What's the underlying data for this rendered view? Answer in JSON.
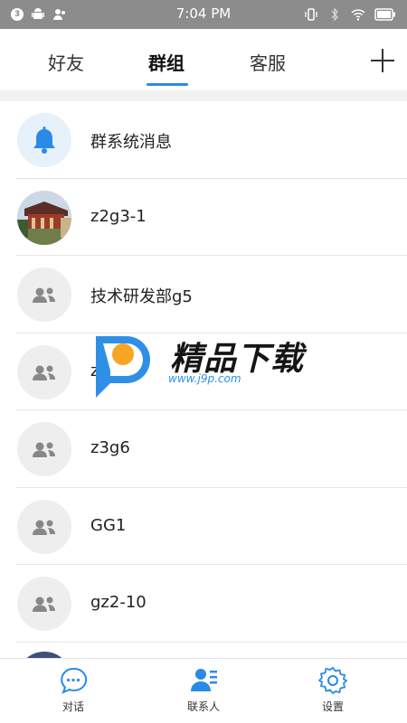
{
  "status_bar": {
    "notification_count": "3",
    "time": "7:04 PM",
    "icons_left": [
      "notification-count-icon",
      "android-icon",
      "contacts-icon"
    ],
    "icons_right": [
      "vibrate-icon",
      "bluetooth-icon",
      "wifi-icon",
      "battery-icon"
    ]
  },
  "tabs": [
    {
      "label": "好友",
      "active": false
    },
    {
      "label": "群组",
      "active": true
    },
    {
      "label": "客服",
      "active": false
    }
  ],
  "add_icon": "plus-icon",
  "groups": [
    {
      "title": "群系统消息",
      "avatar": "bell-icon"
    },
    {
      "title": "z2g3-1",
      "avatar": "photo"
    },
    {
      "title": "技术研发部g5",
      "avatar": "group-icon"
    },
    {
      "title": "z1-1",
      "avatar": "group-icon"
    },
    {
      "title": "z3g6",
      "avatar": "group-icon"
    },
    {
      "title": "GG1",
      "avatar": "group-icon"
    },
    {
      "title": "gz2-10",
      "avatar": "group-icon"
    }
  ],
  "watermark": {
    "title": "精品下载",
    "url": "www.j9p.com"
  },
  "bottom_nav": [
    {
      "label": "对话",
      "icon": "chat-bubble-icon",
      "active": false
    },
    {
      "label": "联系人",
      "icon": "contacts-icon",
      "active": true
    },
    {
      "label": "设置",
      "icon": "settings-gear-icon",
      "active": false
    }
  ],
  "colors": {
    "accent": "#2a8ae8",
    "status_bar": "#8c8c8c",
    "divider": "#e7e7e7"
  }
}
